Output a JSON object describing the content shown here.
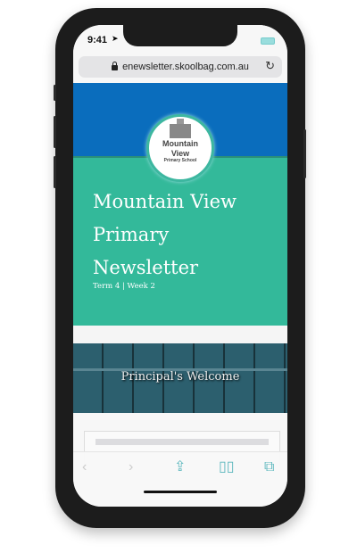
{
  "status_bar": {
    "time": "9:41"
  },
  "browser": {
    "url": "enewsletter.skoolbag.com.au"
  },
  "logo": {
    "line1": "Mountain",
    "line2": "View",
    "line3": "Primary School"
  },
  "header": {
    "title_lines": [
      "Mountain View",
      "Primary",
      "Newsletter"
    ],
    "subtitle": "Term 4 | Week 2"
  },
  "banner": {
    "title": "Principal's Welcome"
  },
  "colors": {
    "blue": "#0a6dbd",
    "green": "#33b99a",
    "banner": "#2c5f6e",
    "toolbar_icons": "#5bb7bd"
  },
  "toolbar": {
    "icons": [
      "back-icon",
      "forward-icon",
      "share-icon",
      "bookmarks-icon",
      "tabs-icon"
    ]
  }
}
